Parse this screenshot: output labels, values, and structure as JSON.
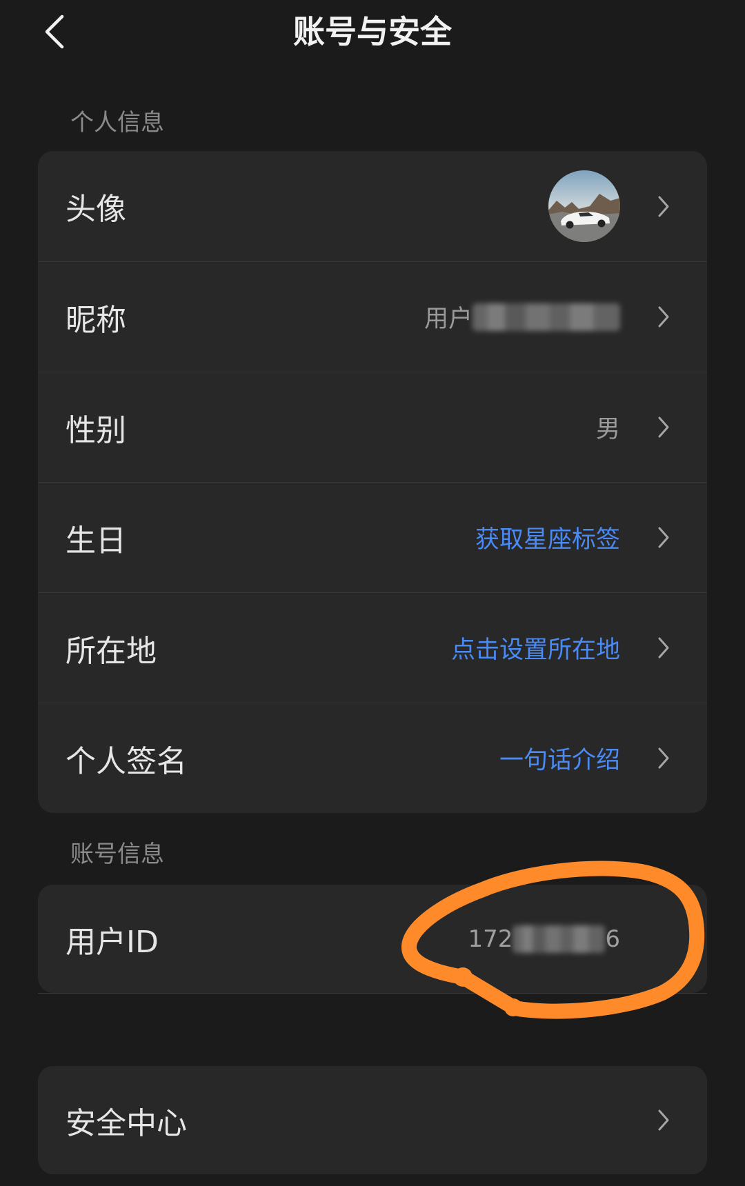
{
  "header": {
    "title": "账号与安全",
    "back_icon": "chevron-left-icon"
  },
  "personal_info": {
    "section_label": "个人信息",
    "row_arrow_icon": "chevron-right-icon",
    "rows": [
      {
        "label": "头像",
        "icon": "avatar-image"
      },
      {
        "label": "昵称",
        "value": "用户"
      },
      {
        "label": "性别",
        "value": "男"
      },
      {
        "label": "生日",
        "value": "获取星座标签"
      },
      {
        "label": "所在地",
        "value": "点击设置所在地"
      },
      {
        "label": "个人签名",
        "value": "一句话介绍"
      }
    ]
  },
  "account_info": {
    "section_label": "账号信息",
    "user_id": {
      "label": "用户ID",
      "value_visible_start": "172",
      "value_visible_end": "6"
    }
  },
  "security": {
    "label": "安全中心",
    "row_arrow_icon": "chevron-right-icon"
  },
  "colors": {
    "page_background": "#1b1b1b",
    "card_background": "#282828",
    "link_text": "#4a8af4",
    "annotation": "#ff8a2a"
  }
}
